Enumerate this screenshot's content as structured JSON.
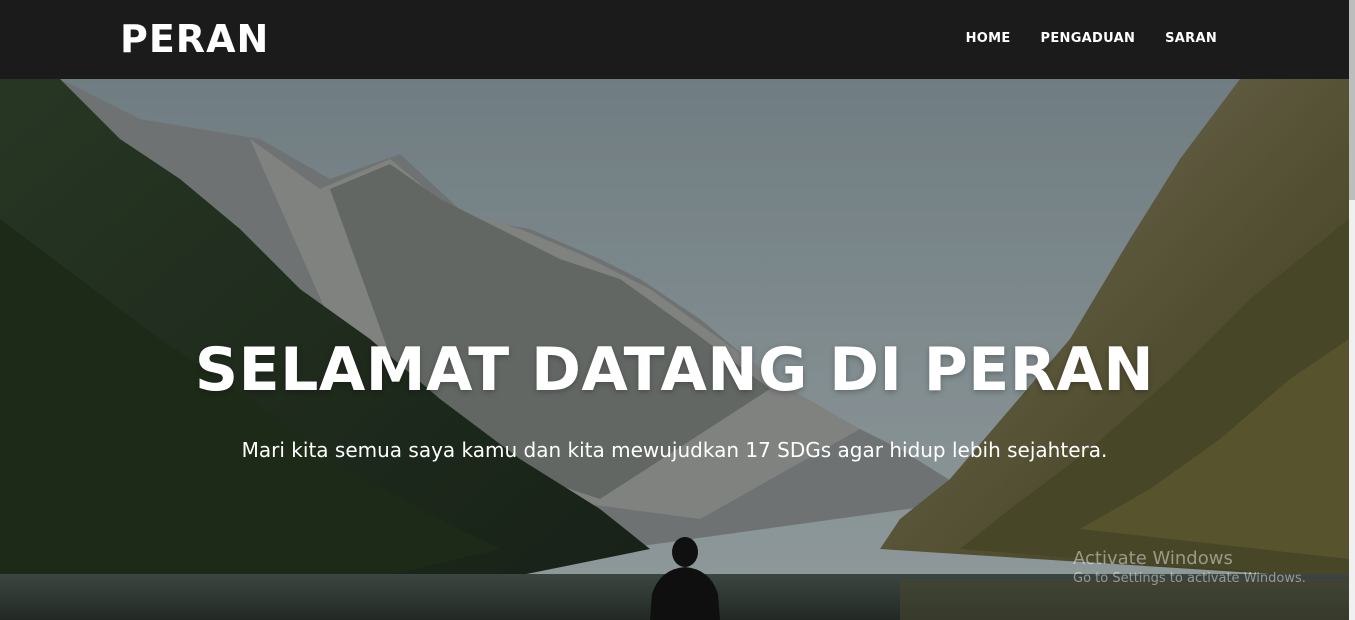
{
  "brand": "PERAN",
  "nav": {
    "items": [
      {
        "label": "HOME"
      },
      {
        "label": "PENGADUAN"
      },
      {
        "label": "SARAN"
      }
    ]
  },
  "hero": {
    "title": "SELAMAT DATANG DI PERAN",
    "subtitle": "Mari kita semua saya kamu dan kita mewujudkan 17 SDGs agar hidup lebih sejahtera."
  },
  "watermark": {
    "title": "Activate Windows",
    "subtitle": "Go to Settings to activate Windows."
  },
  "colors": {
    "navbar": "#1b1b1b",
    "text": "#ffffff"
  }
}
